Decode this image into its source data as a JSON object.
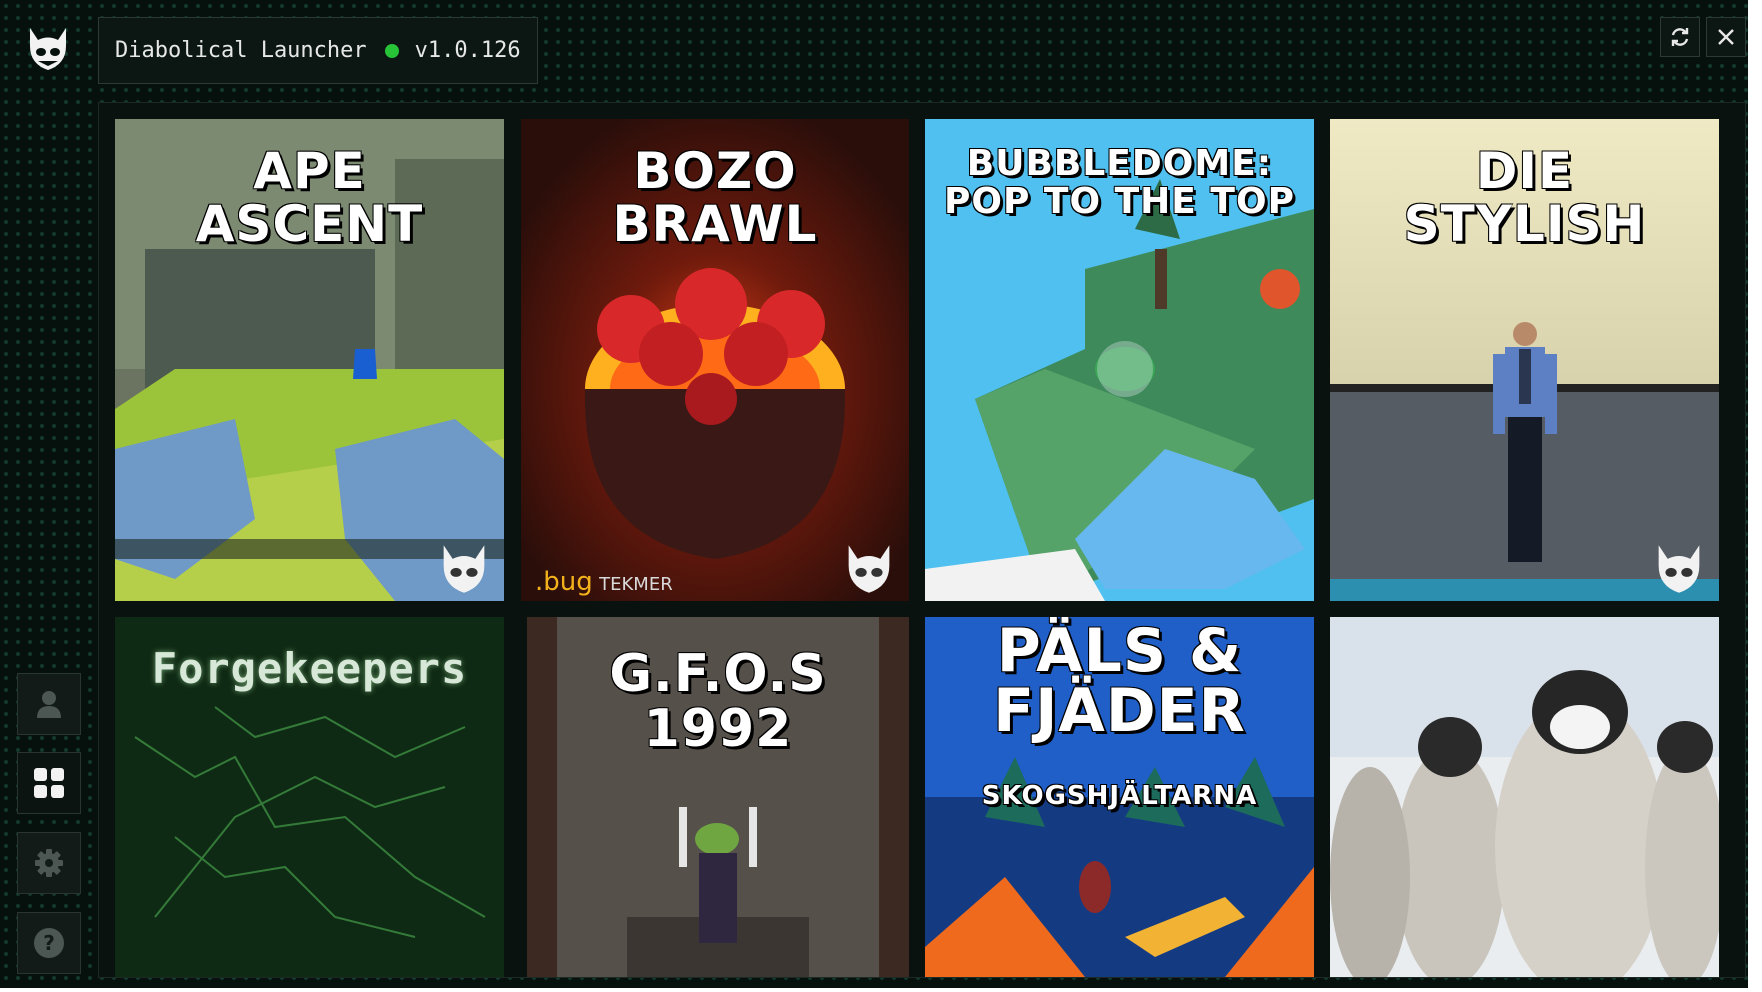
{
  "header": {
    "app_name": "Diabolical Launcher",
    "version": "v1.0.126",
    "status_color": "#27c438"
  },
  "window_controls": {
    "refresh_icon": "refresh-icon",
    "close_icon": "close-icon"
  },
  "sidebar": {
    "items": [
      {
        "id": "profile",
        "icon": "user-icon"
      },
      {
        "id": "library",
        "icon": "grid-icon",
        "active": true
      },
      {
        "id": "settings",
        "icon": "gear-icon"
      },
      {
        "id": "help",
        "icon": "help-icon",
        "glyph": "?"
      }
    ]
  },
  "games": [
    {
      "title": "APE\nASCENT"
    },
    {
      "title": "BOZO\nBRAWL",
      "credit": {
        "studio": ".bug",
        "publisher": "TEKMER"
      }
    },
    {
      "title": "BUBBLEDOME:\nPOP TO THE TOP"
    },
    {
      "title": "DIE\nSTYLISH"
    },
    {
      "title": "Forgekeepers"
    },
    {
      "title": "G.F.O.S\n1992"
    },
    {
      "title": "PÄLS &\nFJÄDER",
      "subtitle": "SKOGSHJÄLTARNA"
    },
    {
      "title": ""
    }
  ]
}
